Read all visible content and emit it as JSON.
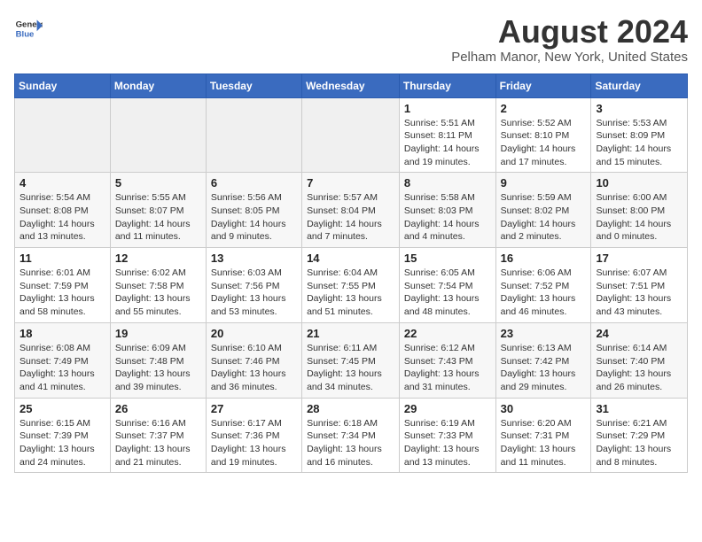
{
  "header": {
    "logo_line1": "General",
    "logo_line2": "Blue",
    "month": "August 2024",
    "location": "Pelham Manor, New York, United States"
  },
  "weekdays": [
    "Sunday",
    "Monday",
    "Tuesday",
    "Wednesday",
    "Thursday",
    "Friday",
    "Saturday"
  ],
  "weeks": [
    [
      {
        "day": "",
        "info": ""
      },
      {
        "day": "",
        "info": ""
      },
      {
        "day": "",
        "info": ""
      },
      {
        "day": "",
        "info": ""
      },
      {
        "day": "1",
        "info": "Sunrise: 5:51 AM\nSunset: 8:11 PM\nDaylight: 14 hours\nand 19 minutes."
      },
      {
        "day": "2",
        "info": "Sunrise: 5:52 AM\nSunset: 8:10 PM\nDaylight: 14 hours\nand 17 minutes."
      },
      {
        "day": "3",
        "info": "Sunrise: 5:53 AM\nSunset: 8:09 PM\nDaylight: 14 hours\nand 15 minutes."
      }
    ],
    [
      {
        "day": "4",
        "info": "Sunrise: 5:54 AM\nSunset: 8:08 PM\nDaylight: 14 hours\nand 13 minutes."
      },
      {
        "day": "5",
        "info": "Sunrise: 5:55 AM\nSunset: 8:07 PM\nDaylight: 14 hours\nand 11 minutes."
      },
      {
        "day": "6",
        "info": "Sunrise: 5:56 AM\nSunset: 8:05 PM\nDaylight: 14 hours\nand 9 minutes."
      },
      {
        "day": "7",
        "info": "Sunrise: 5:57 AM\nSunset: 8:04 PM\nDaylight: 14 hours\nand 7 minutes."
      },
      {
        "day": "8",
        "info": "Sunrise: 5:58 AM\nSunset: 8:03 PM\nDaylight: 14 hours\nand 4 minutes."
      },
      {
        "day": "9",
        "info": "Sunrise: 5:59 AM\nSunset: 8:02 PM\nDaylight: 14 hours\nand 2 minutes."
      },
      {
        "day": "10",
        "info": "Sunrise: 6:00 AM\nSunset: 8:00 PM\nDaylight: 14 hours\nand 0 minutes."
      }
    ],
    [
      {
        "day": "11",
        "info": "Sunrise: 6:01 AM\nSunset: 7:59 PM\nDaylight: 13 hours\nand 58 minutes."
      },
      {
        "day": "12",
        "info": "Sunrise: 6:02 AM\nSunset: 7:58 PM\nDaylight: 13 hours\nand 55 minutes."
      },
      {
        "day": "13",
        "info": "Sunrise: 6:03 AM\nSunset: 7:56 PM\nDaylight: 13 hours\nand 53 minutes."
      },
      {
        "day": "14",
        "info": "Sunrise: 6:04 AM\nSunset: 7:55 PM\nDaylight: 13 hours\nand 51 minutes."
      },
      {
        "day": "15",
        "info": "Sunrise: 6:05 AM\nSunset: 7:54 PM\nDaylight: 13 hours\nand 48 minutes."
      },
      {
        "day": "16",
        "info": "Sunrise: 6:06 AM\nSunset: 7:52 PM\nDaylight: 13 hours\nand 46 minutes."
      },
      {
        "day": "17",
        "info": "Sunrise: 6:07 AM\nSunset: 7:51 PM\nDaylight: 13 hours\nand 43 minutes."
      }
    ],
    [
      {
        "day": "18",
        "info": "Sunrise: 6:08 AM\nSunset: 7:49 PM\nDaylight: 13 hours\nand 41 minutes."
      },
      {
        "day": "19",
        "info": "Sunrise: 6:09 AM\nSunset: 7:48 PM\nDaylight: 13 hours\nand 39 minutes."
      },
      {
        "day": "20",
        "info": "Sunrise: 6:10 AM\nSunset: 7:46 PM\nDaylight: 13 hours\nand 36 minutes."
      },
      {
        "day": "21",
        "info": "Sunrise: 6:11 AM\nSunset: 7:45 PM\nDaylight: 13 hours\nand 34 minutes."
      },
      {
        "day": "22",
        "info": "Sunrise: 6:12 AM\nSunset: 7:43 PM\nDaylight: 13 hours\nand 31 minutes."
      },
      {
        "day": "23",
        "info": "Sunrise: 6:13 AM\nSunset: 7:42 PM\nDaylight: 13 hours\nand 29 minutes."
      },
      {
        "day": "24",
        "info": "Sunrise: 6:14 AM\nSunset: 7:40 PM\nDaylight: 13 hours\nand 26 minutes."
      }
    ],
    [
      {
        "day": "25",
        "info": "Sunrise: 6:15 AM\nSunset: 7:39 PM\nDaylight: 13 hours\nand 24 minutes."
      },
      {
        "day": "26",
        "info": "Sunrise: 6:16 AM\nSunset: 7:37 PM\nDaylight: 13 hours\nand 21 minutes."
      },
      {
        "day": "27",
        "info": "Sunrise: 6:17 AM\nSunset: 7:36 PM\nDaylight: 13 hours\nand 19 minutes."
      },
      {
        "day": "28",
        "info": "Sunrise: 6:18 AM\nSunset: 7:34 PM\nDaylight: 13 hours\nand 16 minutes."
      },
      {
        "day": "29",
        "info": "Sunrise: 6:19 AM\nSunset: 7:33 PM\nDaylight: 13 hours\nand 13 minutes."
      },
      {
        "day": "30",
        "info": "Sunrise: 6:20 AM\nSunset: 7:31 PM\nDaylight: 13 hours\nand 11 minutes."
      },
      {
        "day": "31",
        "info": "Sunrise: 6:21 AM\nSunset: 7:29 PM\nDaylight: 13 hours\nand 8 minutes."
      }
    ]
  ]
}
